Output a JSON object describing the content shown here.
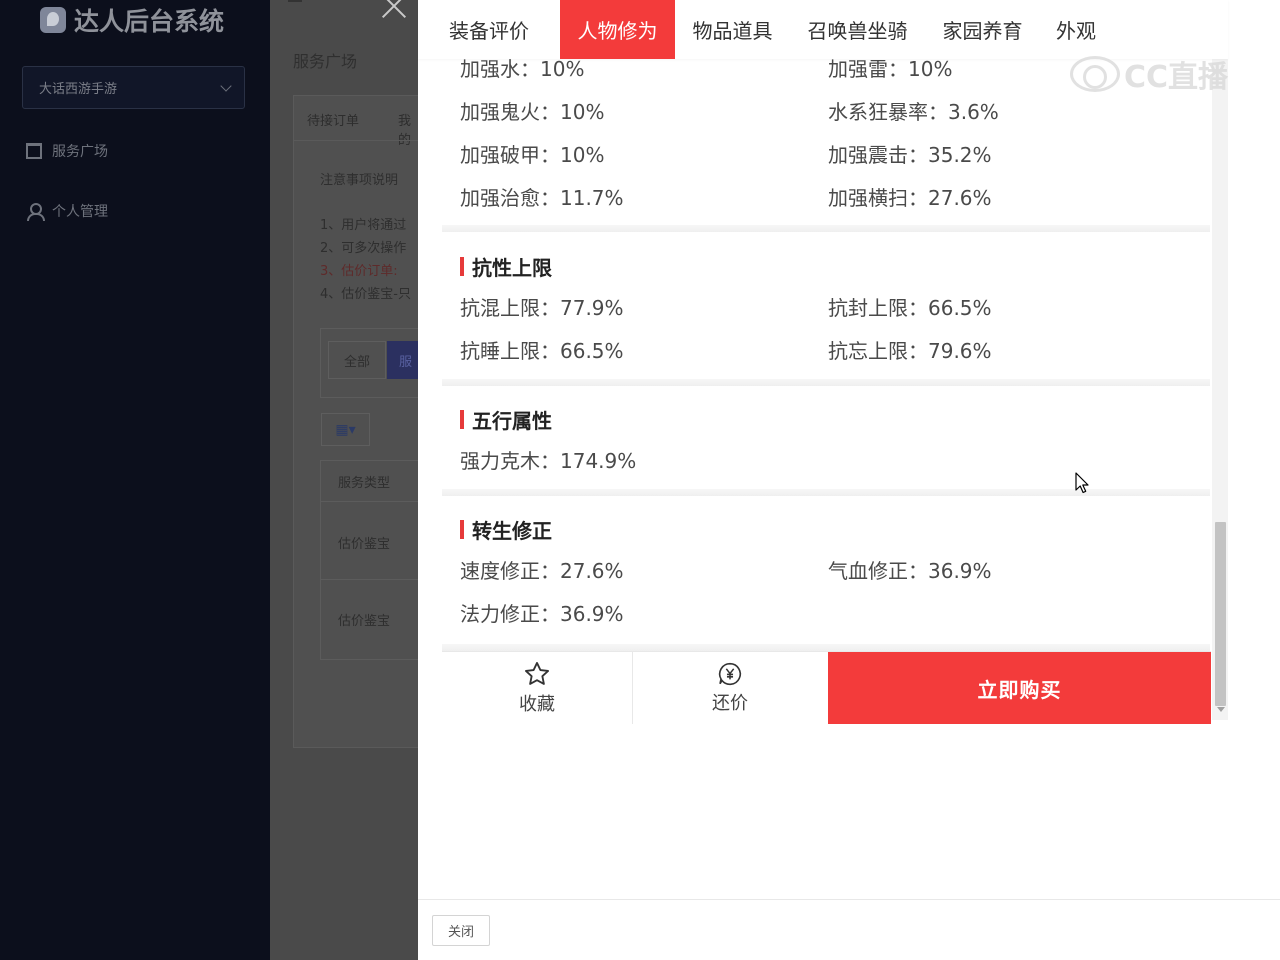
{
  "app": {
    "title": "达人后台系统",
    "game_select": "大话西游手游",
    "nav": [
      {
        "label": "服务广场"
      },
      {
        "label": "个人管理"
      }
    ],
    "page_title": "服务广场",
    "tabs": [
      "待接订单",
      "我的"
    ],
    "notice_title": "注意事项说明",
    "notice_lines": [
      "1、用户将通过",
      "2、可多次操作",
      "3、估价订单:",
      "4、估价鉴宝-只"
    ],
    "filters": [
      "全部",
      "服"
    ],
    "table_header": "服务类型",
    "table_rows": [
      "估价鉴宝",
      "估价鉴宝"
    ]
  },
  "modal": {
    "tabs": [
      {
        "label": "装备评价",
        "active": false
      },
      {
        "label": "人物修为",
        "active": true
      },
      {
        "label": "物品道具",
        "active": false
      },
      {
        "label": "召唤兽坐骑",
        "active": false
      },
      {
        "label": "家园养育",
        "active": false
      },
      {
        "label": "外观",
        "active": false
      }
    ],
    "top_rows": [
      {
        "left": "加强水：10%",
        "right": "加强雷：10%"
      },
      {
        "left": "加强鬼火：10%",
        "right": "水系狂暴率：3.6%"
      },
      {
        "left": "加强破甲：10%",
        "right": "加强震击：35.2%"
      },
      {
        "left": "加强治愈：11.7%",
        "right": "加强横扫：27.6%"
      }
    ],
    "sections": [
      {
        "title": "抗性上限",
        "rows": [
          {
            "left": "抗混上限：77.9%",
            "right": "抗封上限：66.5%"
          },
          {
            "left": "抗睡上限：66.5%",
            "right": "抗忘上限：79.6%"
          }
        ]
      },
      {
        "title": "五行属性",
        "rows": [
          {
            "left": "强力克木：174.9%",
            "right": ""
          }
        ]
      },
      {
        "title": "转生修正",
        "rows": [
          {
            "left": "速度修正：27.6%",
            "right": "气血修正：36.9%"
          },
          {
            "left": "法力修正：36.9%",
            "right": ""
          }
        ]
      }
    ],
    "actions": {
      "favorite": "收藏",
      "bargain": "还价",
      "buy": "立即购买"
    },
    "close": "关闭"
  },
  "watermark": "CC直播",
  "colors": {
    "accent": "#f33b3b",
    "sidebar": "#0c0f1c",
    "section_bar": "#e63a3a"
  }
}
